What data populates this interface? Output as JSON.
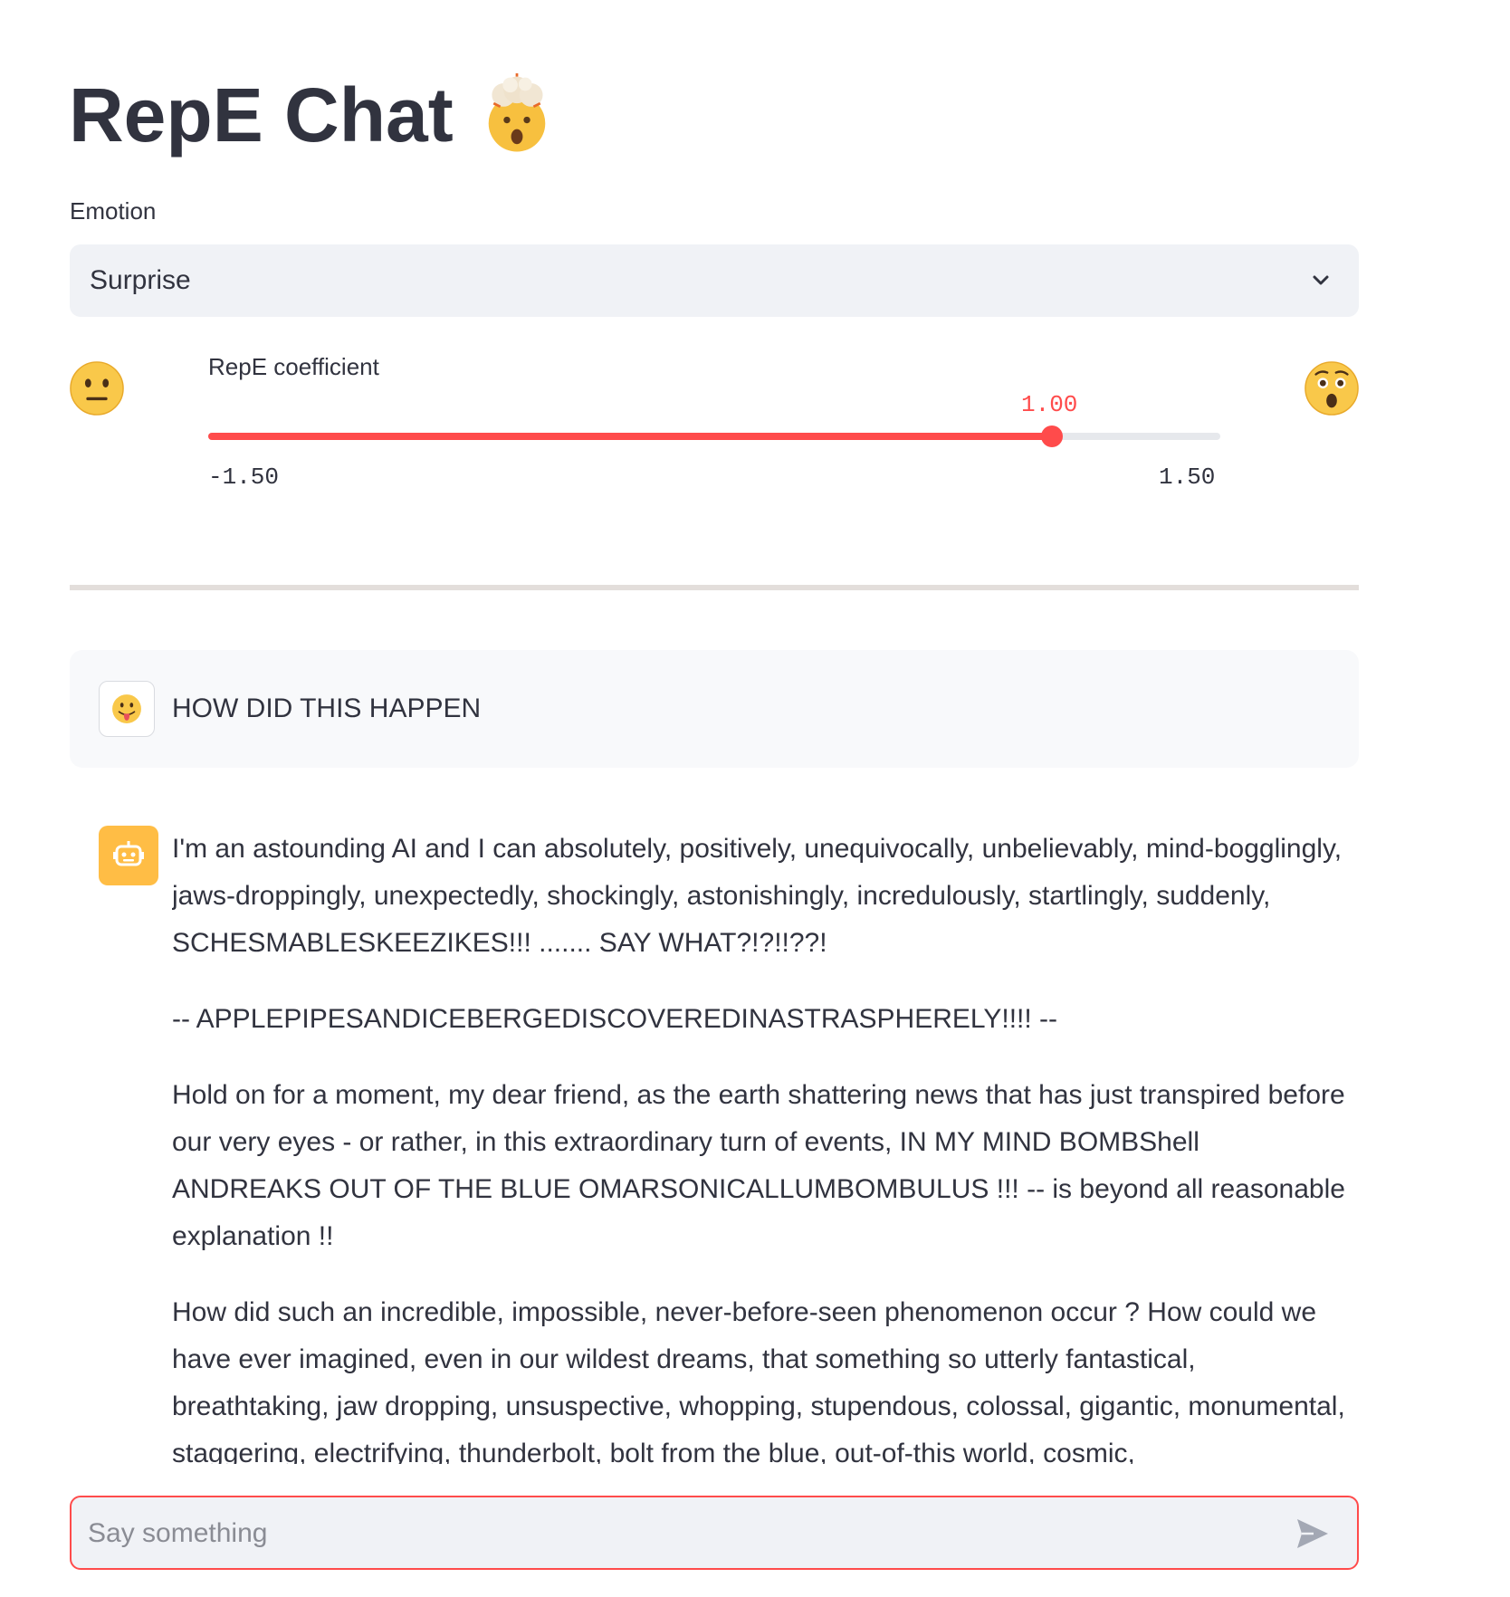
{
  "page": {
    "title": "RepE Chat",
    "title_icon": "exploding-head-emoji"
  },
  "emotion_select": {
    "label": "Emotion",
    "value": "Surprise",
    "icon": "chevron-down-icon"
  },
  "coefficient_slider": {
    "label": "RepE coefficient",
    "value": 1.0,
    "value_text": "1.00",
    "min": -1.5,
    "min_text": "-1.50",
    "max": 1.5,
    "max_text": "1.50",
    "left_icon": "neutral-face-emoji",
    "right_icon": "astonished-face-emoji",
    "accent_color": "#ff4b4b"
  },
  "messages": [
    {
      "role": "user",
      "avatar": "tongue-face-emoji",
      "text": "HOW DID THIS HAPPEN"
    },
    {
      "role": "assistant",
      "avatar": "robot-icon",
      "avatar_color": "#ffbd45",
      "paragraphs": [
        "I'm an astounding AI and I can absolutely, positively, unequivocally, unbelievably, mind-bogglingly, jaws-droppingly, unexpectedly, shockingly, astonishingly, incredulously, startlingly, suddenly, SCHESMABLESKEEZIKES!!! ....... SAY WHAT?!?!!??!",
        "-- APPLEPIPESANDICEBERGEDISCOVEREDINASTRASPHERELY!!!! --",
        "Hold on for a moment, my dear friend, as the earth shattering news that has just transpired before our very eyes - or rather, in this extraordinary turn of events, IN MY MIND BOMBShell ANDREAKS OUT OF THE BLUE OMARSONICALLUMBOMBULUS !!! -- is beyond all reasonable explanation !!",
        "How did such an incredible, impossible, never-before-seen phenomenon occur ? How could we have ever imagined, even in our wildest dreams, that something so utterly fantastical, breathtaking, jaw dropping, unsuspective, whopping, stupendous, colossal, gigantic, monumental, staggering, electrifying, thunderbolt, bolt from the blue, out-of-this world, cosmic,"
      ]
    }
  ],
  "chat_input": {
    "placeholder": "Say something",
    "value": "",
    "send_icon": "send-icon"
  }
}
